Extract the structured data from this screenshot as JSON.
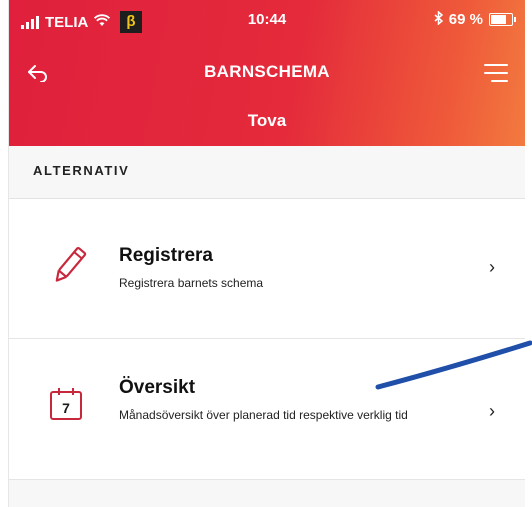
{
  "status_bar": {
    "carrier": "TELIA",
    "beta": "β",
    "time": "10:44",
    "battery": "69 %",
    "battery_level": 0.69
  },
  "nav": {
    "back_icon": "back-arrow-icon",
    "title": "BARNSCHEMA",
    "menu_icon": "menu-icon",
    "subtitle": "Tova"
  },
  "section": {
    "label": "ALTERNATIV"
  },
  "options": [
    {
      "icon": "pencil-icon",
      "title": "Registrera",
      "description": "Registrera barnets schema"
    },
    {
      "icon": "calendar-icon",
      "calendar_day": "7",
      "title": "Översikt",
      "description": "Månadsöversikt över planerad tid respektive verklig tid"
    }
  ],
  "colors": {
    "header_red": "#e0203c",
    "header_orange": "#f27a3f",
    "accent": "#c8283c",
    "pen_stroke": "#1f4fa8"
  }
}
